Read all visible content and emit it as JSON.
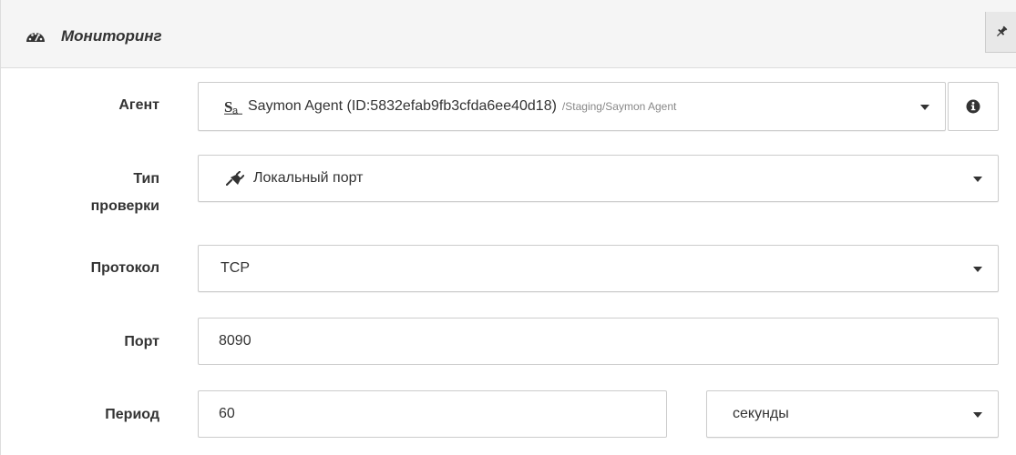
{
  "panel": {
    "title": "Мониторинг",
    "header_icon": "tachometer-icon",
    "pin_icon": "pin-icon"
  },
  "form": {
    "agent": {
      "label": "Агент",
      "icon": "saymon-agent-icon",
      "value": "Saymon Agent (ID:5832efab9fb3cfda6ee40d18)",
      "path": "/Staging/Saymon Agent",
      "info_icon": "info-circle-icon"
    },
    "check_type": {
      "label_line1": "Тип",
      "label_line2": "проверки",
      "icon": "plug-icon",
      "value": "Локальный порт"
    },
    "protocol": {
      "label": "Протокол",
      "value": "TCP"
    },
    "port": {
      "label": "Порт",
      "value": "8090"
    },
    "period": {
      "label": "Период",
      "value": "60",
      "unit": "секунды"
    }
  }
}
